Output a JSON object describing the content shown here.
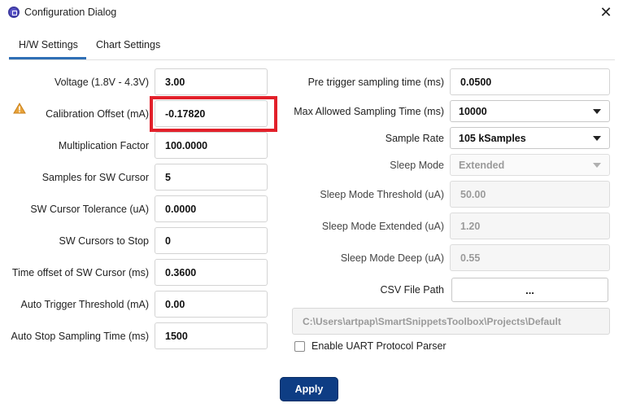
{
  "window": {
    "title": "Configuration Dialog",
    "close_glyph": "✕"
  },
  "tabs": [
    {
      "label": "H/W Settings",
      "active": true
    },
    {
      "label": "Chart Settings",
      "active": false
    }
  ],
  "left": {
    "voltage": {
      "label": "Voltage (1.8V - 4.3V)",
      "value": "3.00"
    },
    "calibration_offset": {
      "label": "Calibration Offset (mA)",
      "value": "-0.17820",
      "warning_icon": "warning-triangle-icon"
    },
    "multiplication_factor": {
      "label": "Multiplication Factor",
      "value": "100.0000"
    },
    "samples_sw_cursor": {
      "label": "Samples for SW Cursor",
      "value": "5"
    },
    "sw_cursor_tolerance": {
      "label": "SW Cursor Tolerance (uA)",
      "value": "0.0000"
    },
    "sw_cursors_to_stop": {
      "label": "SW Cursors to Stop",
      "value": "0"
    },
    "time_offset_sw_cursor": {
      "label": "Time offset of SW Cursor (ms)",
      "value": "0.3600"
    },
    "auto_trigger_threshold": {
      "label": "Auto Trigger Threshold (mA)",
      "value": "0.00"
    },
    "auto_stop_sampling_time": {
      "label": "Auto Stop Sampling Time (ms)",
      "value": "1500"
    }
  },
  "right": {
    "pre_trigger_sampling_time": {
      "label": "Pre trigger sampling time (ms)",
      "value": "0.0500"
    },
    "max_allowed_sampling_time": {
      "label": "Max Allowed Sampling Time (ms)",
      "value": "10000"
    },
    "sample_rate": {
      "label": "Sample Rate",
      "value": "105 kSamples"
    },
    "sleep_mode": {
      "label": "Sleep Mode",
      "value": "Extended"
    },
    "sleep_mode_threshold": {
      "label": "Sleep Mode Threshold (uA)",
      "value": "50.00"
    },
    "sleep_mode_extended": {
      "label": "Sleep Mode Extended (uA)",
      "value": "1.20"
    },
    "sleep_mode_deep": {
      "label": "Sleep Mode Deep (uA)",
      "value": "0.55"
    },
    "csv_file_path": {
      "label": "CSV File Path",
      "browse_label": "...",
      "path": "C:\\Users\\artpap\\SmartSnippetsToolbox\\Projects\\Default"
    },
    "uart_parser": {
      "label": "Enable UART Protocol Parser",
      "checked": false
    }
  },
  "apply_label": "Apply",
  "colors": {
    "accent": "#2f6fb5",
    "apply_bg": "#0e3d84",
    "highlight": "#e2202a",
    "warning": "#e8a33a"
  }
}
